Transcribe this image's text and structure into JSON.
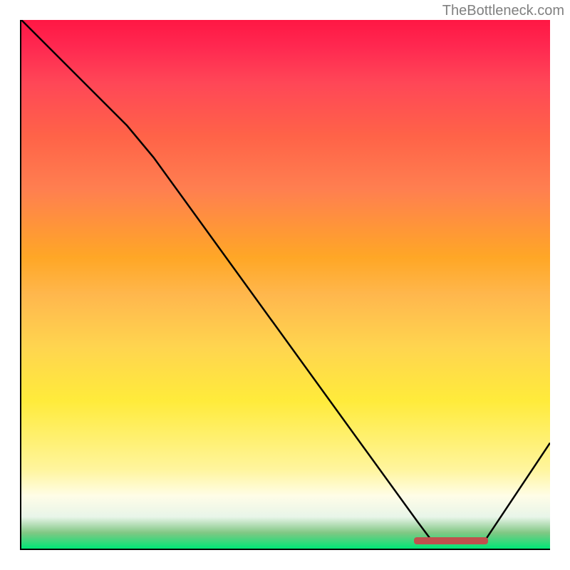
{
  "watermark": "TheBottleneck.com",
  "chart_data": {
    "type": "line",
    "title": "",
    "xlabel": "",
    "ylabel": "",
    "watermark": "TheBottleneck.com",
    "curve_points": [
      {
        "x": 0,
        "y": 100
      },
      {
        "x": 20,
        "y": 80
      },
      {
        "x": 25,
        "y": 74
      },
      {
        "x": 75,
        "y": 5
      },
      {
        "x": 78,
        "y": 1
      },
      {
        "x": 86,
        "y": 1
      },
      {
        "x": 88,
        "y": 2
      },
      {
        "x": 100,
        "y": 20
      }
    ],
    "optimal_range": {
      "start": 74,
      "end": 88
    },
    "gradient": {
      "colors": [
        "#ff1744",
        "#ffa726",
        "#ffeb3b",
        "#fffde7",
        "#00e676"
      ],
      "description": "red-to-green vertical gradient representing bottleneck severity"
    },
    "xlim": [
      0,
      100
    ],
    "ylim": [
      0,
      100
    ]
  }
}
